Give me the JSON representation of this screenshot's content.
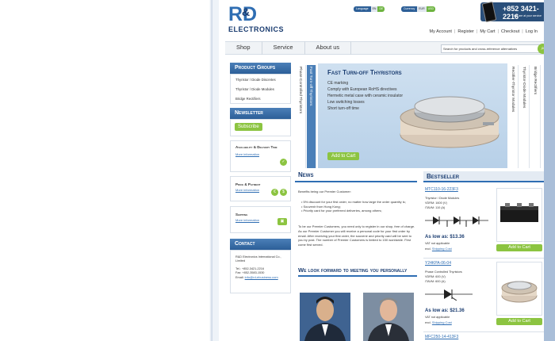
{
  "brand": {
    "rd": "RD",
    "amp": "&",
    "electronics": "ELECTRONICS"
  },
  "language": {
    "label": "Language",
    "options": [
      "EN",
      "DE"
    ]
  },
  "currency": {
    "label": "Currency",
    "options": [
      "EUR",
      "USD"
    ]
  },
  "phone": {
    "number": "+852 3421-2216",
    "sub": "We are at your service"
  },
  "top_links": [
    "My Account",
    "Register",
    "My Cart",
    "Checkout",
    "Log In"
  ],
  "nav": [
    "Shop",
    "Service",
    "About us"
  ],
  "search": {
    "placeholder": "Search for products and cross-reference alternatives"
  },
  "sidebar": {
    "product_groups_title": "Product Groups",
    "product_groups": [
      "Thyristor / Diode Discretes",
      "Thyristor / Diode Modules",
      "Bridge Rectifiers"
    ],
    "newsletter_title": "Newsletter",
    "subscribe_label": "Subscribe",
    "availability_title": "Availability & Delivery Time",
    "availability_link": "More information",
    "payment_title": "Price & Payment",
    "payment_link": "More information",
    "shipping_title": "Shipping",
    "shipping_link": "More information",
    "contact_title": "Contact",
    "contact_lines": [
      "R&D Electronics International Co., Limited",
      "",
      "Tel.: +852-3421-2216",
      "Fax: +852-3583-1530",
      "Email:"
    ],
    "contact_email": "info@rd-ebusiness.com"
  },
  "tabs_left": [
    "Phase Controlled Thyristors",
    "Fast Turn-off Thyristors"
  ],
  "tabs_right": [
    "Rectifier-Thyristor Modules",
    "Thyristor-Diode Modules",
    "Bridge Rectifiers"
  ],
  "banner": {
    "title": "Fast Turn-off Thyristors",
    "features": [
      "CE marking",
      "Comply with European RoHS directives",
      "Hermetic metal case with ceramic insulator",
      "Low switching losses",
      "Short turn-off time"
    ],
    "add_label": "Add to Cart"
  },
  "news": {
    "title": "News",
    "intro": "Benefits being our Premier Customer:",
    "list": [
      "5% discount for your first order, no matter how large the order quantity is;",
      "Souvenir from Hong Kong;",
      "Priority card for your preferred deliveries, among others;"
    ],
    "para": "To be our Premier Customers, you need only to register in our shop, free of charge. As our Premier Customer you will receive a personal code for your first order by email. After receiving your first order, the souvenir and priority card will be sent to you by post. The number of Premier Customers is limited to 150 worldwide. First come first served.",
    "subtitle": "We look forward to meeting you personally"
  },
  "bestseller": {
    "title": "Bestseller",
    "products": [
      {
        "name": "MTC110-16-223F3",
        "category": "Thyristor / Diode Modules",
        "v": "VDRM: 1600 (V)",
        "i": "ITAVM: 110 (A)",
        "price": "As low as: $13.36",
        "vat": "VAT not applicable",
        "excl": "excl.",
        "shipping": "Shipping Cost",
        "add": "Add to Cart"
      },
      {
        "name": "Y24KPA-06-04",
        "category": "Phase Controlled Thyristors",
        "v": "VDRM: 600 (V)",
        "i": "ITAVM: 600 (A)",
        "price": "As low as: $21.36",
        "vat": "VAT not applicable",
        "excl": "excl.",
        "shipping": "Shipping Cost",
        "add": "Add to Cart"
      }
    ],
    "partial": "MFC250-14-413F3"
  }
}
